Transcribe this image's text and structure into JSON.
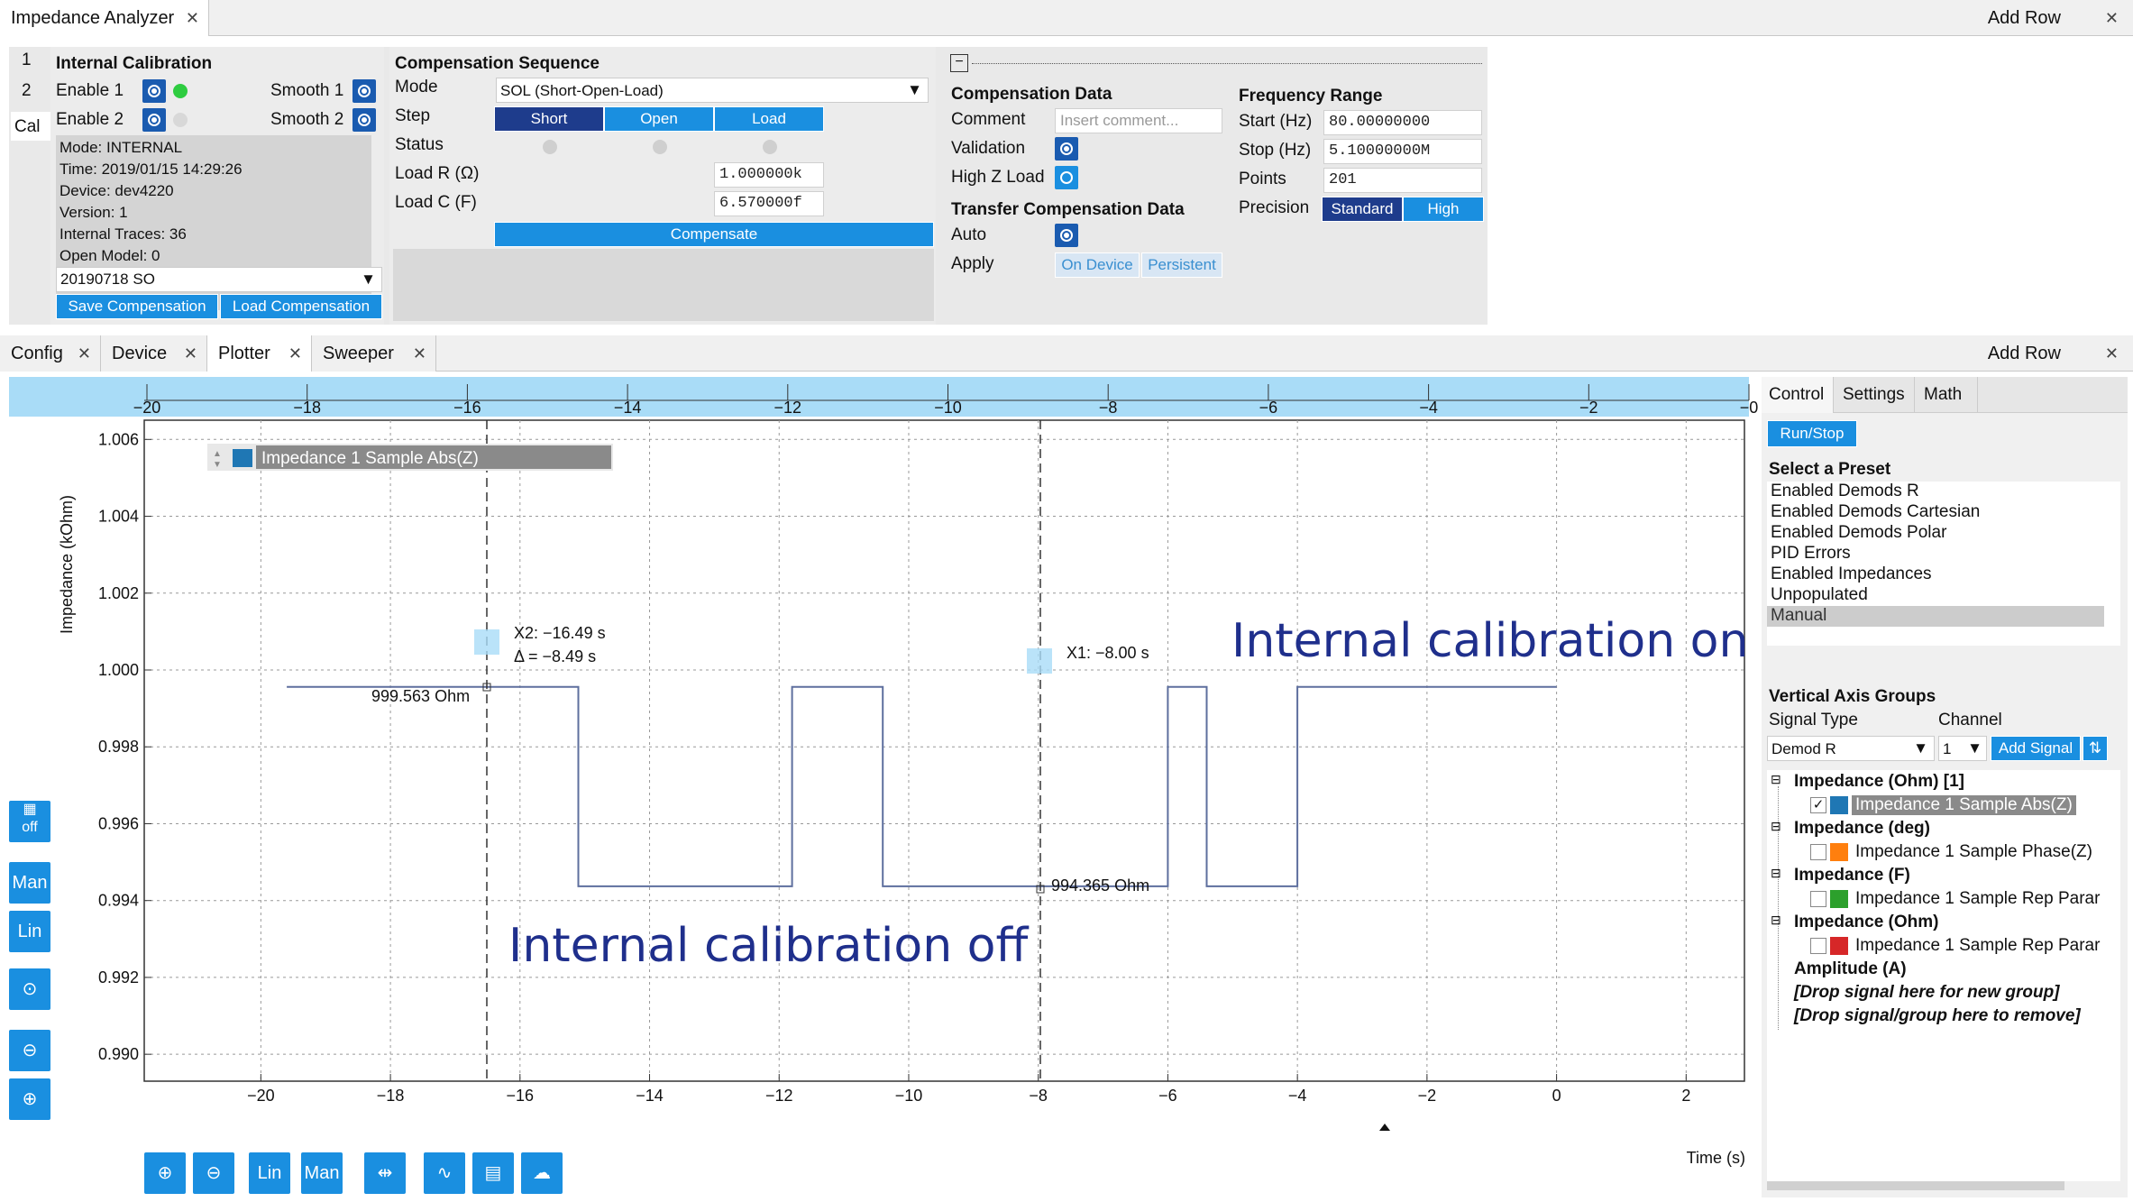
{
  "top_tabs": {
    "title": "Impedance Analyzer",
    "add_row": "Add Row"
  },
  "side_tabs": [
    "1",
    "2",
    "Cal"
  ],
  "internal_cal": {
    "title": "Internal Calibration",
    "enable1": "Enable 1",
    "enable2": "Enable 2",
    "smooth1": "Smooth 1",
    "smooth2": "Smooth 2",
    "info": [
      "Mode: INTERNAL",
      "Time: 2019/01/15 14:29:26",
      "Device: dev4220",
      "Version: 1",
      "Internal Traces: 36",
      "Open Model: 0"
    ],
    "file": "20190718 SO",
    "save": "Save Compensation",
    "load": "Load Compensation"
  },
  "comp_seq": {
    "title": "Compensation Sequence",
    "mode_label": "Mode",
    "mode_value": "SOL (Short-Open-Load)",
    "step_label": "Step",
    "steps": [
      "Short",
      "Open",
      "Load"
    ],
    "status_label": "Status",
    "loadr_label": "Load R (Ω)",
    "loadr_value": "1.000000k",
    "loadc_label": "Load C (F)",
    "loadc_value": "6.570000f",
    "compensate": "Compensate"
  },
  "comp_data": {
    "title": "Compensation Data",
    "comment_label": "Comment",
    "comment_placeholder": "Insert comment...",
    "validation_label": "Validation",
    "highz_label": "High Z Load"
  },
  "transfer": {
    "title": "Transfer Compensation Data",
    "auto_label": "Auto",
    "apply_label": "Apply",
    "on_device": "On Device",
    "persistent": "Persistent"
  },
  "freq": {
    "title": "Frequency Range",
    "start_label": "Start (Hz)",
    "start_value": "80.00000000",
    "stop_label": "Stop (Hz)",
    "stop_value": "5.10000000M",
    "points_label": "Points",
    "points_value": "201",
    "precision_label": "Precision",
    "precision_options": [
      "Standard",
      "High"
    ]
  },
  "bottom_tabs": [
    {
      "label": "Config"
    },
    {
      "label": "Device"
    },
    {
      "label": "Plotter"
    },
    {
      "label": "Sweeper"
    }
  ],
  "plot": {
    "top_ticks": [
      "−20",
      "−18",
      "−16",
      "−14",
      "−12",
      "−10",
      "−8",
      "−6",
      "−4",
      "−2",
      "−0"
    ],
    "x_ticks": [
      "−20",
      "−18",
      "−16",
      "−14",
      "−12",
      "−10",
      "−8",
      "−6",
      "−4",
      "−2",
      "0",
      "2"
    ],
    "y_ticks": [
      "1.006",
      "1.004",
      "1.002",
      "1.000",
      "0.998",
      "0.996",
      "0.994",
      "0.992",
      "0.990"
    ],
    "ylabel": "Impedance (kOhm)",
    "xlabel": "Time (s)",
    "legend": "Impedance 1 Sample Abs(Z)",
    "cursor_x2": "X2: −16.49 s",
    "cursor_delta": "Δ = −8.49 s",
    "cursor_x1": "X1: −8.00 s",
    "val1": "999.563 Ohm",
    "val2": "994.365 Ohm",
    "annot_on": "Internal calibration on",
    "annot_off": "Internal calibration off",
    "line_color": "#5e6f9e",
    "side_buttons": [
      "off",
      "Man",
      "Lin"
    ],
    "bottom_buttons": [
      "Lin",
      "Man"
    ]
  },
  "chart_data": {
    "type": "line",
    "xlabel": "Time (s)",
    "ylabel": "Impedance (kOhm)",
    "xlim": [
      -21.8,
      2.9
    ],
    "ylim": [
      0.9893,
      1.0065
    ],
    "series": [
      {
        "name": "Impedance 1 Sample Abs(Z)",
        "x": [
          -19.6,
          -15.1,
          -15.1,
          -11.8,
          -11.8,
          -10.4,
          -10.4,
          -8.0,
          -6.0,
          -6.0,
          -5.4,
          -5.4,
          -4.0,
          -4.0,
          0.0
        ],
        "y": [
          0.99956,
          0.99956,
          0.99437,
          0.99437,
          0.99956,
          0.99956,
          0.99437,
          0.99437,
          0.99437,
          0.99956,
          0.99956,
          0.99437,
          0.99437,
          0.99956,
          0.99956
        ]
      }
    ]
  },
  "control": {
    "tabs": [
      "Control",
      "Settings",
      "Math"
    ],
    "run_stop": "Run/Stop",
    "preset_title": "Select a Preset",
    "presets": [
      "Enabled Demods R",
      "Enabled Demods Cartesian",
      "Enabled Demods Polar",
      "PID Errors",
      "Enabled Impedances",
      "Unpopulated",
      "Manual"
    ],
    "vag_title": "Vertical Axis Groups",
    "signal_type_label": "Signal Type",
    "channel_label": "Channel",
    "signal_type": "Demod R",
    "channel": "1",
    "add_signal": "Add Signal",
    "groups": [
      {
        "name": "Impedance (Ohm) [1]",
        "item": "Impedance 1 Sample Abs(Z)",
        "color": "#1f77b4"
      },
      {
        "name": "Impedance (deg)",
        "item": "Impedance 1 Sample Phase(Z)",
        "color": "#ff7f0e"
      },
      {
        "name": "Impedance (F)",
        "item": "Impedance 1 Sample Rep Parar",
        "color": "#2ca02c"
      },
      {
        "name": "Impedance (Ohm)",
        "item": "Impedance 1 Sample Rep Parar",
        "color": "#d62728"
      }
    ],
    "amplitude": "Amplitude (A)",
    "drop_new": "[Drop signal here for new group]",
    "drop_remove": "[Drop signal/group here to remove]"
  }
}
